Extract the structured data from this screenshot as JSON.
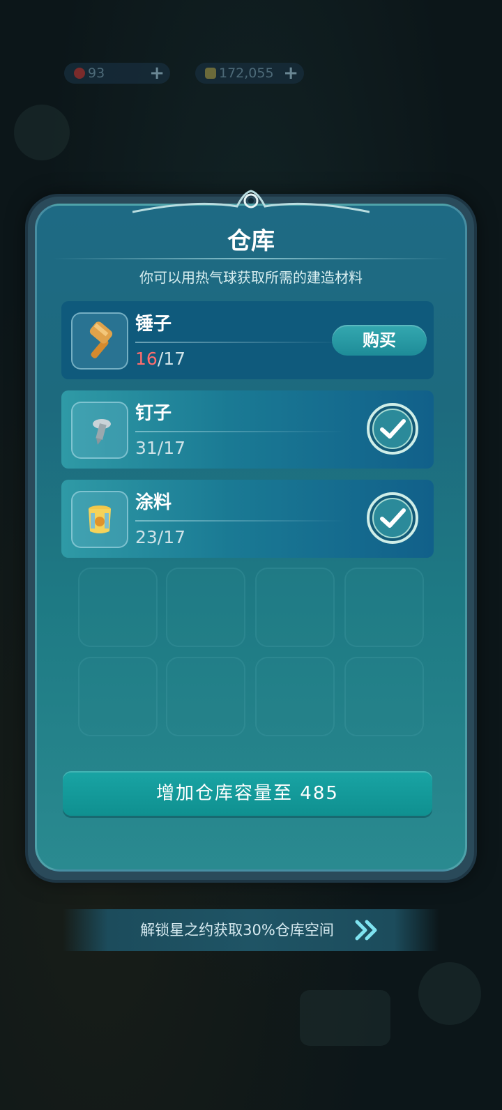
{
  "currency": {
    "hearts": "93",
    "coins": "172,055"
  },
  "warehouse": {
    "title": "仓库",
    "subtitle": "你可以用热气球获取所需的建造材料",
    "items": [
      {
        "name": "锤子",
        "have": "16",
        "need": "/17",
        "action": "购买",
        "status": "insufficient"
      },
      {
        "name": "钉子",
        "count": "31/17",
        "status": "complete"
      },
      {
        "name": "涂料",
        "count": "23/17",
        "status": "complete"
      }
    ],
    "expand_button": "增加仓库容量至 485"
  },
  "banner": {
    "text": "解锁星之约获取30%仓库空间"
  },
  "colors": {
    "accent_teal": "#19a4a4",
    "shortage_red": "#ff6d6d",
    "panel_blue": "#1e6a84"
  }
}
